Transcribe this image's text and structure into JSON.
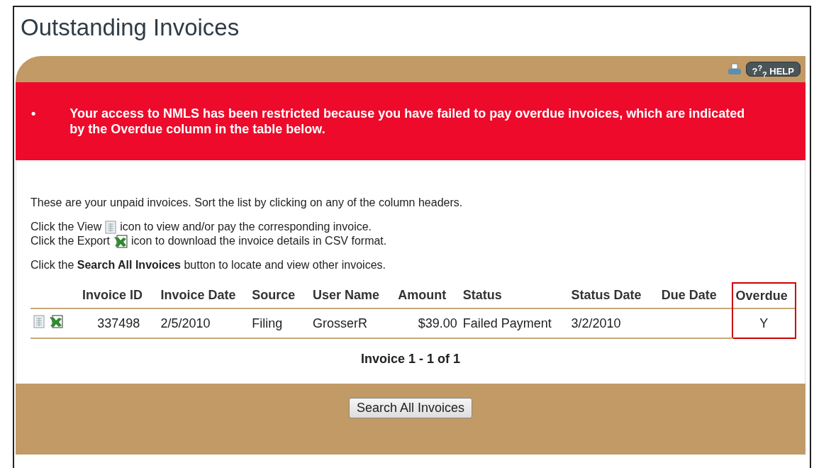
{
  "title": "Outstanding Invoices",
  "help": {
    "label": "?$^{?}$$_{?}$ HELP"
  },
  "alert": {
    "bullet": "•",
    "message": "Your access to NMLS has been restricted because you have failed to pay overdue invoices, which are indicated by the Overdue column in the table below."
  },
  "instructions": [
    {
      "kind": "text",
      "text": "These are your unpaid invoices. Sort the list by clicking on any of the column headers."
    },
    {
      "kind": "view",
      "before": "Click the View",
      "after": "icon to view and/or pay the corresponding invoice."
    },
    {
      "kind": "export",
      "before": "Click the Export",
      "after": "icon to download the invoice details in CSV format."
    },
    {
      "kind": "text",
      "text": "Click the **Search All Invoices** button to locate and view other invoices."
    }
  ],
  "table": {
    "columns": [
      {
        "label": "Invoice ID",
        "highlighted": false
      },
      {
        "label": "Invoice Date",
        "highlighted": false
      },
      {
        "label": "Source",
        "highlighted": false
      },
      {
        "label": "User Name",
        "highlighted": false
      },
      {
        "label": "Amount",
        "highlighted": false
      },
      {
        "label": "Status",
        "highlighted": false
      },
      {
        "label": "Status Date",
        "highlighted": false
      },
      {
        "label": "Due Date",
        "highlighted": false
      },
      {
        "label": "Overdue",
        "highlighted": true
      }
    ],
    "rows": [
      {
        "cells": [
          "337498",
          "2/5/2010",
          "Filing",
          "GrosserR",
          "$39.00",
          "Failed Payment",
          "3/2/2010",
          "",
          "Y"
        ]
      }
    ]
  },
  "pagination": "Invoice 1 - 1 of 1",
  "search_button": "Search All Invoices"
}
